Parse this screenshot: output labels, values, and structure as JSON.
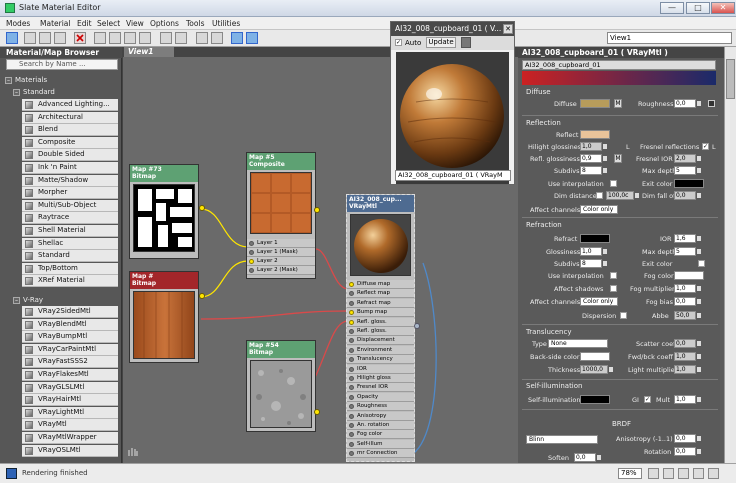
{
  "window": {
    "title": "Slate Material Editor",
    "min": "—",
    "max": "□",
    "close": "✕"
  },
  "menu": [
    "Modes",
    "Material",
    "Edit",
    "Select",
    "View",
    "Options",
    "Tools",
    "Utilities"
  ],
  "toolbar": {
    "view_selector": "View1"
  },
  "browser": {
    "title": "Material/Map Browser",
    "search_placeholder": "Search by Name ...",
    "group_materials": "Materials",
    "group_standard": "Standard",
    "group_vray": "V-Ray",
    "standard_items": [
      "Advanced Lighting...",
      "Architectural",
      "Blend",
      "Composite",
      "Double Sided",
      "Ink 'n Paint",
      "Matte/Shadow",
      "Morpher",
      "Multi/Sub-Object",
      "Raytrace",
      "Shell Material",
      "Shellac",
      "Standard",
      "Top/Bottom",
      "XRef Material"
    ],
    "vray_items": [
      "VRay2SidedMtl",
      "VRayBlendMtl",
      "VRayBumpMtl",
      "VRayCarPaintMtl",
      "VRayFastSSS2",
      "VRayFlakesMtl",
      "VRayGLSLMtl",
      "VRayHairMtl",
      "VRayLightMtl",
      "VRayMtl",
      "VRayMtlWrapper",
      "VRayOSLMtl"
    ]
  },
  "view": {
    "tab": "View1"
  },
  "nodes": {
    "map73": {
      "title": "Map #73",
      "type": "Bitmap"
    },
    "map5": {
      "title": "Map #5",
      "type": "Composite",
      "slots": [
        "Layer 1",
        "Layer 1 (Mask)",
        "Layer 2",
        "Layer 2 (Mask)"
      ]
    },
    "mapX": {
      "title": "Map #",
      "type": "Bitmap"
    },
    "map54": {
      "title": "Map #54",
      "type": "Bitmap"
    },
    "vray": {
      "title": "AI32_008_cup...",
      "type": "VRayMtl",
      "slots": [
        "Diffuse map",
        "Reflect map",
        "Refract map",
        "Bump map",
        "Refl. gloss.",
        "Refl. gloss.",
        "Displacement",
        "Environment",
        "Translucency",
        "IOR",
        "Hilight gloss",
        "Fresnel IOR",
        "Opacity",
        "Roughness",
        "Anisotropy",
        "An. rotation",
        "Fog color",
        "Self-illum",
        "mr Connection"
      ]
    }
  },
  "preview": {
    "title": "AI32_008_cupboard_01  ( V...",
    "auto": "Auto",
    "update": "Update",
    "footer": "AI32_008_cupboard_01  ( VRayM"
  },
  "params": {
    "title": "AI32_008_cupboard_01  ( VRayMtl )",
    "name_field": "AI32_008_cupboard_01",
    "diffuse": {
      "section": "Diffuse",
      "diffuse": "Diffuse",
      "roughness": "Roughness",
      "roughness_val": "0,0",
      "m": "M"
    },
    "reflection": {
      "section": "Reflection",
      "reflect": "Reflect",
      "hilight_glossiness": "Hilight glossiness",
      "hilight_val": "1,0",
      "l": "L",
      "fresnel_reflections": "Fresnel reflections",
      "fresnel_l": "L",
      "refl_glossiness": "Refl. glossiness",
      "refl_val": "0,9",
      "m": "M",
      "fresnel_ior": "Fresnel IOR",
      "fresnel_ior_val": "2,0",
      "subdivs": "Subdivs",
      "subdivs_val": "8",
      "max_depth": "Max depth",
      "max_depth_val": "5",
      "use_interpolation": "Use interpolation",
      "exit_color": "Exit color",
      "dim_distance": "Dim distance",
      "dim_distance_val": "100,0c",
      "dim_fall_off": "Dim fall off",
      "dim_fall_off_val": "0,0",
      "affect_channels": "Affect channels",
      "affect_channels_val": "Color only"
    },
    "refraction": {
      "section": "Refraction",
      "refract": "Refract",
      "ior": "IOR",
      "ior_val": "1,6",
      "glossiness": "Glossiness",
      "glossiness_val": "1,0",
      "max_depth": "Max depth",
      "max_depth_val": "5",
      "subdivs": "Subdivs",
      "subdivs_val": "8",
      "exit_color": "Exit color",
      "use_interpolation": "Use interpolation",
      "fog_color": "Fog color",
      "affect_shadows": "Affect shadows",
      "fog_multiplier": "Fog multiplier",
      "fog_multiplier_val": "1,0",
      "affect_channels": "Affect channels",
      "affect_channels_val": "Color only",
      "fog_bias": "Fog bias",
      "fog_bias_val": "0,0",
      "dispersion": "Dispersion",
      "abbe": "Abbe",
      "abbe_val": "50,0"
    },
    "translucency": {
      "section": "Translucency",
      "type": "Type",
      "type_val": "None",
      "scatter_coeff": "Scatter coeff",
      "scatter_val": "0,0",
      "back_side_color": "Back-side color",
      "fwd_bck": "Fwd/bck coeff",
      "fwd_bck_val": "1,0",
      "thickness": "Thickness",
      "thickness_val": "1000,0",
      "light_multiplier": "Light multiplier",
      "light_multiplier_val": "1,0"
    },
    "self_illum": {
      "section": "Self-illumination",
      "self_illumination": "Self-illumination",
      "gi": "GI",
      "mult": "Mult",
      "mult_val": "1,0"
    },
    "brdf": {
      "section": "BRDF",
      "type_val": "Blinn",
      "anisotropy": "Anisotropy (-1..1)",
      "anisotropy_val": "0,0",
      "rotation": "Rotation",
      "rotation_val": "0,0",
      "soften": "Soften",
      "soften_val": "0,0"
    }
  },
  "status": {
    "text": "Rendering finished",
    "zoom": "78%"
  },
  "colors": {
    "diffuse": "#b79c5b",
    "reflect": "#e8c39a",
    "node_green": "#5ea173",
    "node_red": "#a3262a",
    "wire_red": "#d94a4a",
    "pin_yellow": "#ffe600"
  }
}
